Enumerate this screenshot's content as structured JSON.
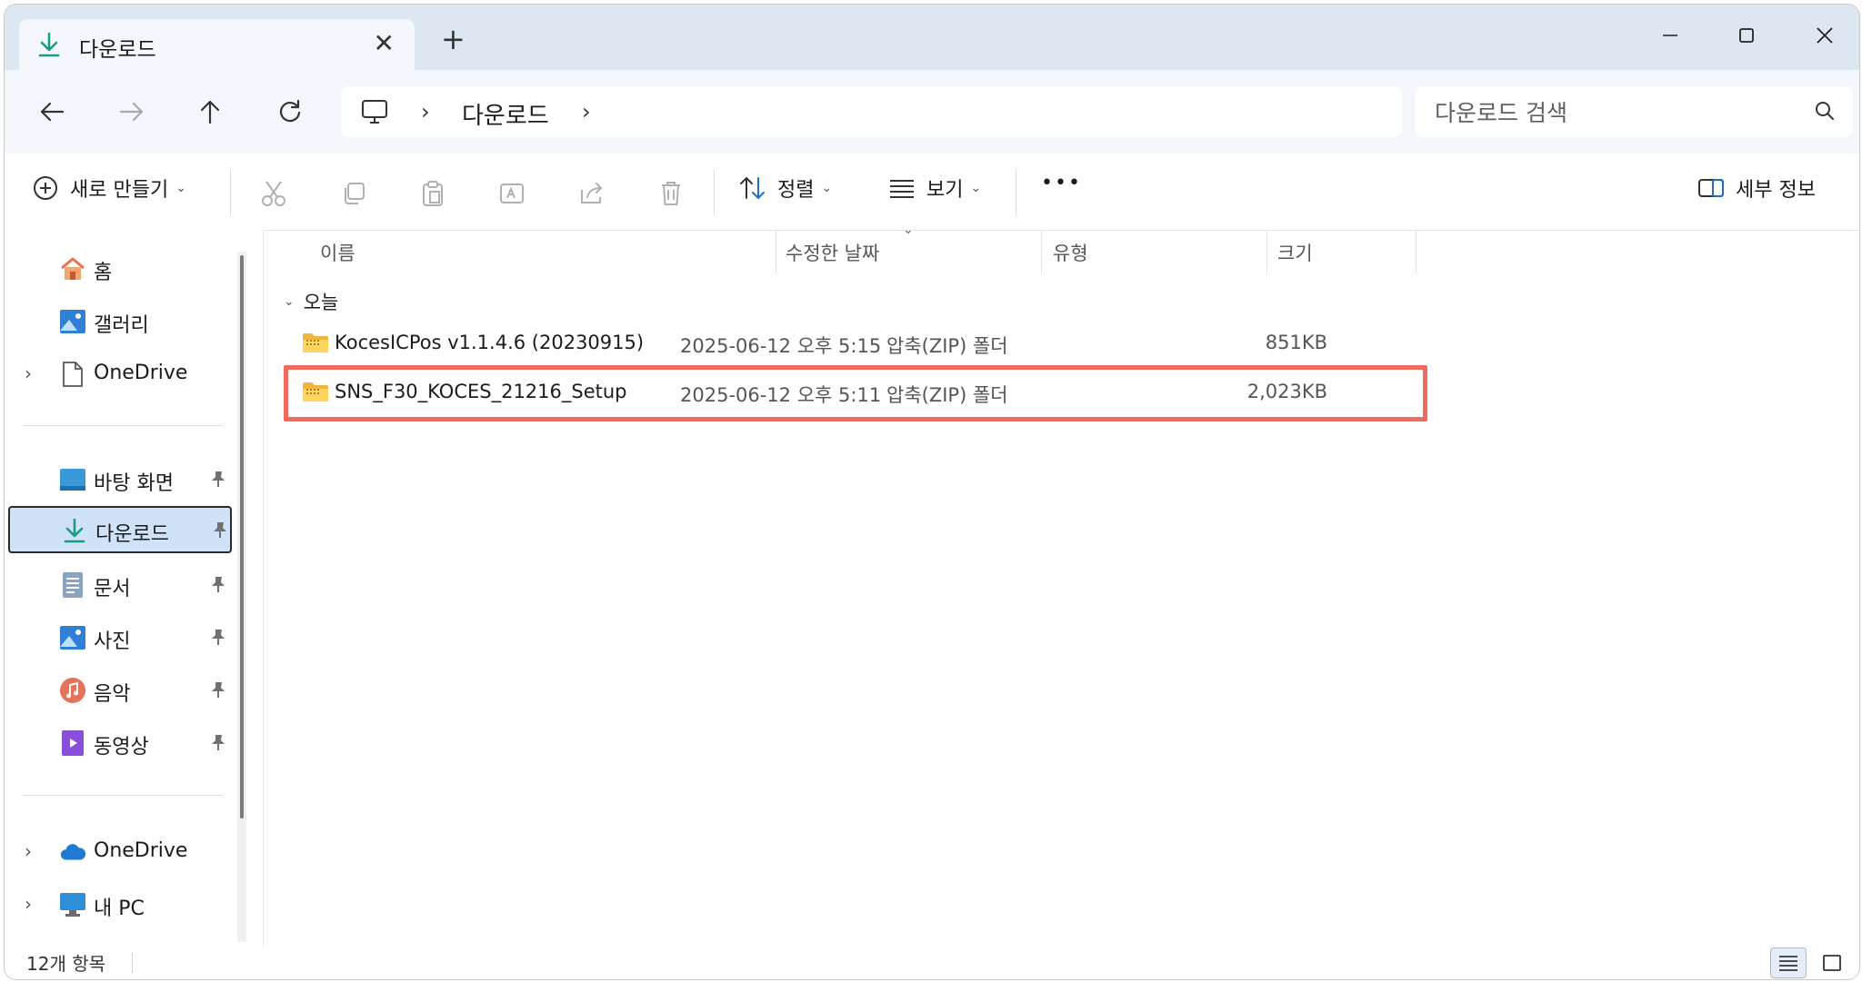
{
  "tab": {
    "title": "다운로드",
    "close_glyph": "✕",
    "newtab_glyph": "+"
  },
  "address": {
    "crumbs": [
      "다운로드"
    ],
    "separator": "›"
  },
  "search": {
    "placeholder": "다운로드 검색"
  },
  "toolbar": {
    "new_label": "새로 만들기",
    "sort_label": "정렬",
    "view_label": "보기",
    "more_glyph": "•••",
    "details_label": "세부 정보",
    "dropdown_glyph": "⌄"
  },
  "columns": {
    "name": "이름",
    "date": "수정한 날짜",
    "type": "유형",
    "size": "크기"
  },
  "group": {
    "label": "오늘"
  },
  "files": [
    {
      "name": "KocesICPos v1.1.4.6 (20230915)",
      "date": "2025-06-12 오후 5:15",
      "type": "압축(ZIP) 폴더",
      "size": "851KB"
    },
    {
      "name": "SNS_F30_KOCES_21216_Setup",
      "date": "2025-06-12 오후 5:11",
      "type": "압축(ZIP) 폴더",
      "size": "2,023KB"
    }
  ],
  "sidebar": {
    "top": [
      {
        "label": "홈",
        "icon": "home-icon"
      },
      {
        "label": "갤러리",
        "icon": "gallery-icon"
      },
      {
        "label": "OneDrive",
        "icon": "document-icon",
        "expandable": true
      }
    ],
    "pinned": [
      {
        "label": "바탕 화면",
        "icon": "desktop-icon"
      },
      {
        "label": "다운로드",
        "icon": "download-icon",
        "selected": true
      },
      {
        "label": "문서",
        "icon": "documents-icon"
      },
      {
        "label": "사진",
        "icon": "pictures-icon"
      },
      {
        "label": "음악",
        "icon": "music-icon"
      },
      {
        "label": "동영상",
        "icon": "videos-icon"
      }
    ],
    "bottom": [
      {
        "label": "OneDrive",
        "icon": "cloud-icon",
        "expandable": true
      },
      {
        "label": "내 PC",
        "icon": "pc-icon",
        "expandable": true
      }
    ]
  },
  "status": {
    "item_count": "12개 항목"
  },
  "colors": {
    "highlight": "#f06a5d",
    "selected_bg": "#cfe2f7",
    "accent": "#1a9c7e"
  }
}
